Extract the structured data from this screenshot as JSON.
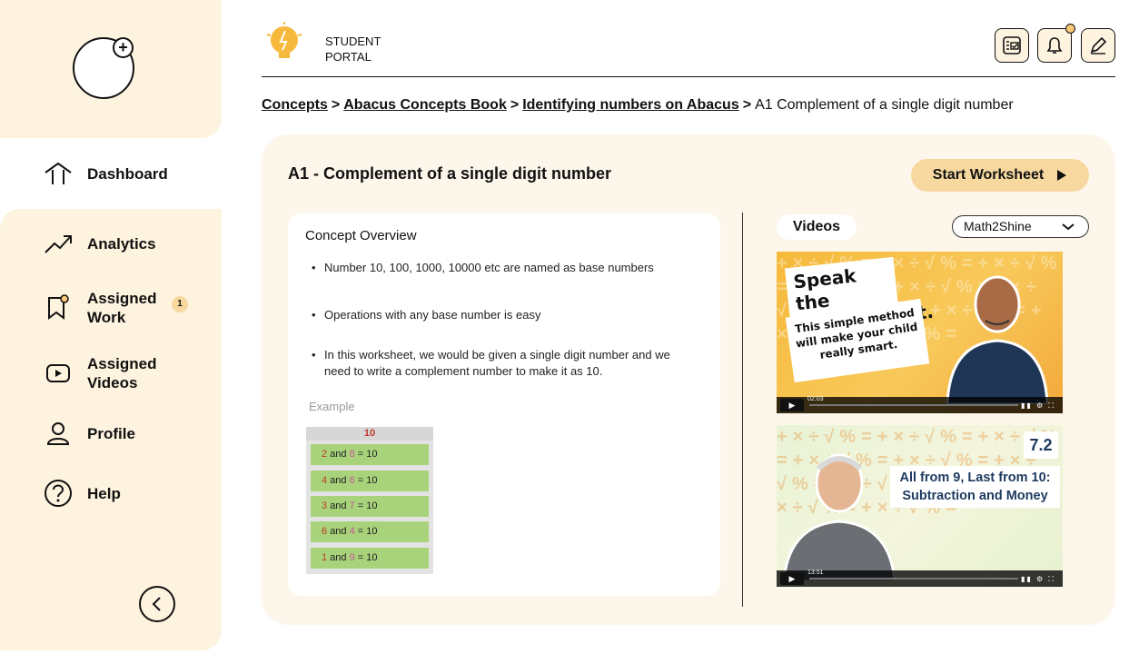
{
  "header": {
    "portal_line1": "STUDENT",
    "portal_line2": "PORTAL",
    "icons": [
      "checklist-icon",
      "bell-icon",
      "pen-icon"
    ]
  },
  "sidebar": {
    "items": [
      {
        "label": "Dashboard",
        "icon": "home-icon",
        "active": true
      },
      {
        "label": "Analytics",
        "icon": "trend-icon"
      },
      {
        "label": "Assigned Work",
        "icon": "assignment-icon",
        "badge": "1"
      },
      {
        "label": "Assigned Videos",
        "icon": "video-icon"
      },
      {
        "label": "Profile",
        "icon": "user-icon"
      },
      {
        "label": "Help",
        "icon": "help-icon"
      }
    ]
  },
  "breadcrumb": {
    "items": [
      "Concepts",
      "Abacus Concepts Book",
      "Identifying numbers on Abacus"
    ],
    "separator": ">",
    "current": "A1 Complement of a single digit number"
  },
  "concept": {
    "title": "A1 - Complement of a single digit number",
    "start_button": "Start Worksheet",
    "overview_title": "Concept Overview",
    "bullets": [
      "Number 10, 100, 1000, 10000 etc are named as base numbers",
      "Operations with any base number is easy",
      "In this worksheet, we would be given a single digit number and we need to write a complement number to make it as 10."
    ],
    "example_label": "Example",
    "example_table": {
      "header": "10",
      "rows": [
        {
          "a": "2",
          "b": "8",
          "sum": "10"
        },
        {
          "a": "4",
          "b": "6",
          "sum": "10"
        },
        {
          "a": "3",
          "b": "7",
          "sum": "10"
        },
        {
          "a": "6",
          "b": "4",
          "sum": "10"
        },
        {
          "a": "1",
          "b": "9",
          "sum": "10"
        }
      ],
      "and_word": "and",
      "equals": "="
    }
  },
  "videos": {
    "label": "Videos",
    "channel": "Math2Shine",
    "items": [
      {
        "title_line1": "Speak the",
        "title_line2": "Complement.",
        "subtitle": "This simple method will make your child really smart.",
        "time": "02:03"
      },
      {
        "number": "7.2",
        "caption": "All from 9, Last from 10: Subtraction and Money",
        "time": "13:51"
      }
    ]
  },
  "colors": {
    "sidebar_bg": "#fdf3df",
    "card_bg": "#fdf6ea",
    "accent": "#f7d9a0",
    "example_row": "#a8d37a"
  }
}
